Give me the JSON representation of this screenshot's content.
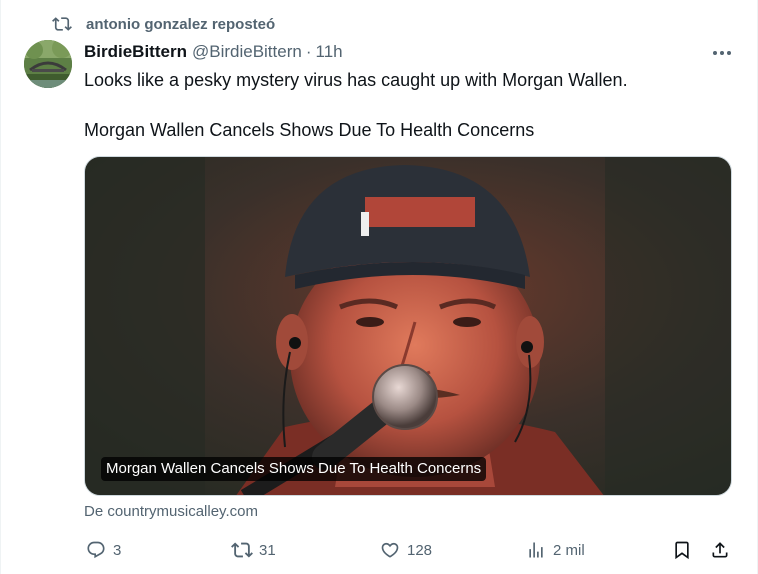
{
  "repost_banner": {
    "icon": "repost-icon",
    "text": "antonio gonzalez reposteó"
  },
  "author": {
    "display_name": "BirdieBittern",
    "handle": "@BirdieBittern",
    "separator": "·",
    "time": "11h"
  },
  "tweet": {
    "line1": "Looks like a pesky mystery virus has caught up with Morgan Wallen.",
    "line2": "Morgan Wallen Cancels Shows Due To Health Concerns"
  },
  "media": {
    "caption": "Morgan Wallen Cancels Shows Due To Health Concerns"
  },
  "source": "De countrymusicalley.com",
  "actions": {
    "reply_count": "3",
    "repost_count": "31",
    "like_count": "128",
    "views_count": "2 mil"
  },
  "colors": {
    "text_primary": "#0f1419",
    "text_secondary": "#536471",
    "border": "#cfd9de"
  }
}
